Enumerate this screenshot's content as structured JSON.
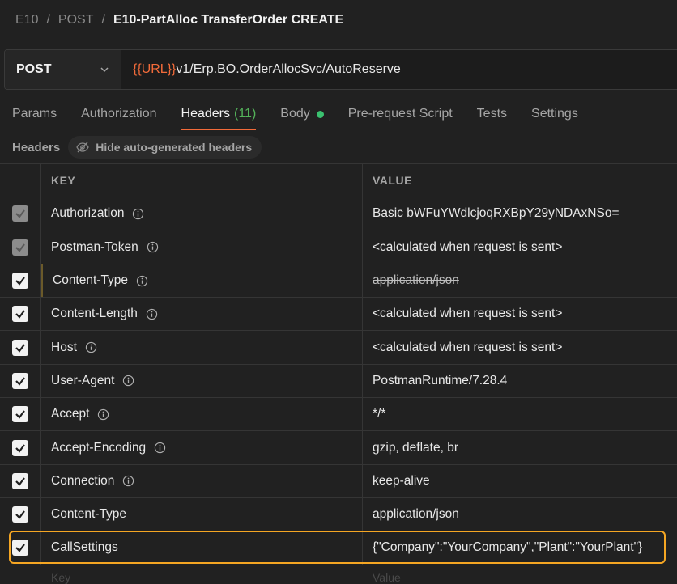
{
  "breadcrumb": {
    "items": [
      "E10",
      "POST"
    ],
    "current": "E10-PartAlloc TransferOrder CREATE"
  },
  "request": {
    "method": "POST",
    "url_var": "{{URL}}",
    "url_path": "v1/Erp.BO.OrderAllocSvc/AutoReserve"
  },
  "tabs": {
    "params": "Params",
    "authorization": "Authorization",
    "headers": "Headers",
    "headers_count": "(11)",
    "body": "Body",
    "prerequest": "Pre-request Script",
    "tests": "Tests",
    "settings": "Settings"
  },
  "subheader": {
    "label": "Headers",
    "hide_button": "Hide auto-generated headers"
  },
  "table": {
    "col_key": "KEY",
    "col_value": "VALUE",
    "rows": [
      {
        "key": "Authorization",
        "value": "Basic bWFuYWdlcjoqRXBpY29yNDAxNSo="
      },
      {
        "key": "Postman-Token",
        "value": "<calculated when request is sent>"
      },
      {
        "key": "Content-Type",
        "value": "application/json"
      },
      {
        "key": "Content-Length",
        "value": "<calculated when request is sent>"
      },
      {
        "key": "Host",
        "value": "<calculated when request is sent>"
      },
      {
        "key": "User-Agent",
        "value": "PostmanRuntime/7.28.4"
      },
      {
        "key": "Accept",
        "value": "*/*"
      },
      {
        "key": "Accept-Encoding",
        "value": "gzip, deflate, br"
      },
      {
        "key": "Connection",
        "value": "keep-alive"
      },
      {
        "key": "Content-Type",
        "value": "application/json"
      },
      {
        "key": "CallSettings",
        "value": "{\"Company\":\"YourCompany\",\"Plant\":\"YourPlant\"}"
      }
    ],
    "ghost_key": "Key",
    "ghost_value": "Value"
  },
  "colors": {
    "accent": "#f26b3a",
    "count_green": "#54b35a",
    "highlight": "#f5a623"
  }
}
